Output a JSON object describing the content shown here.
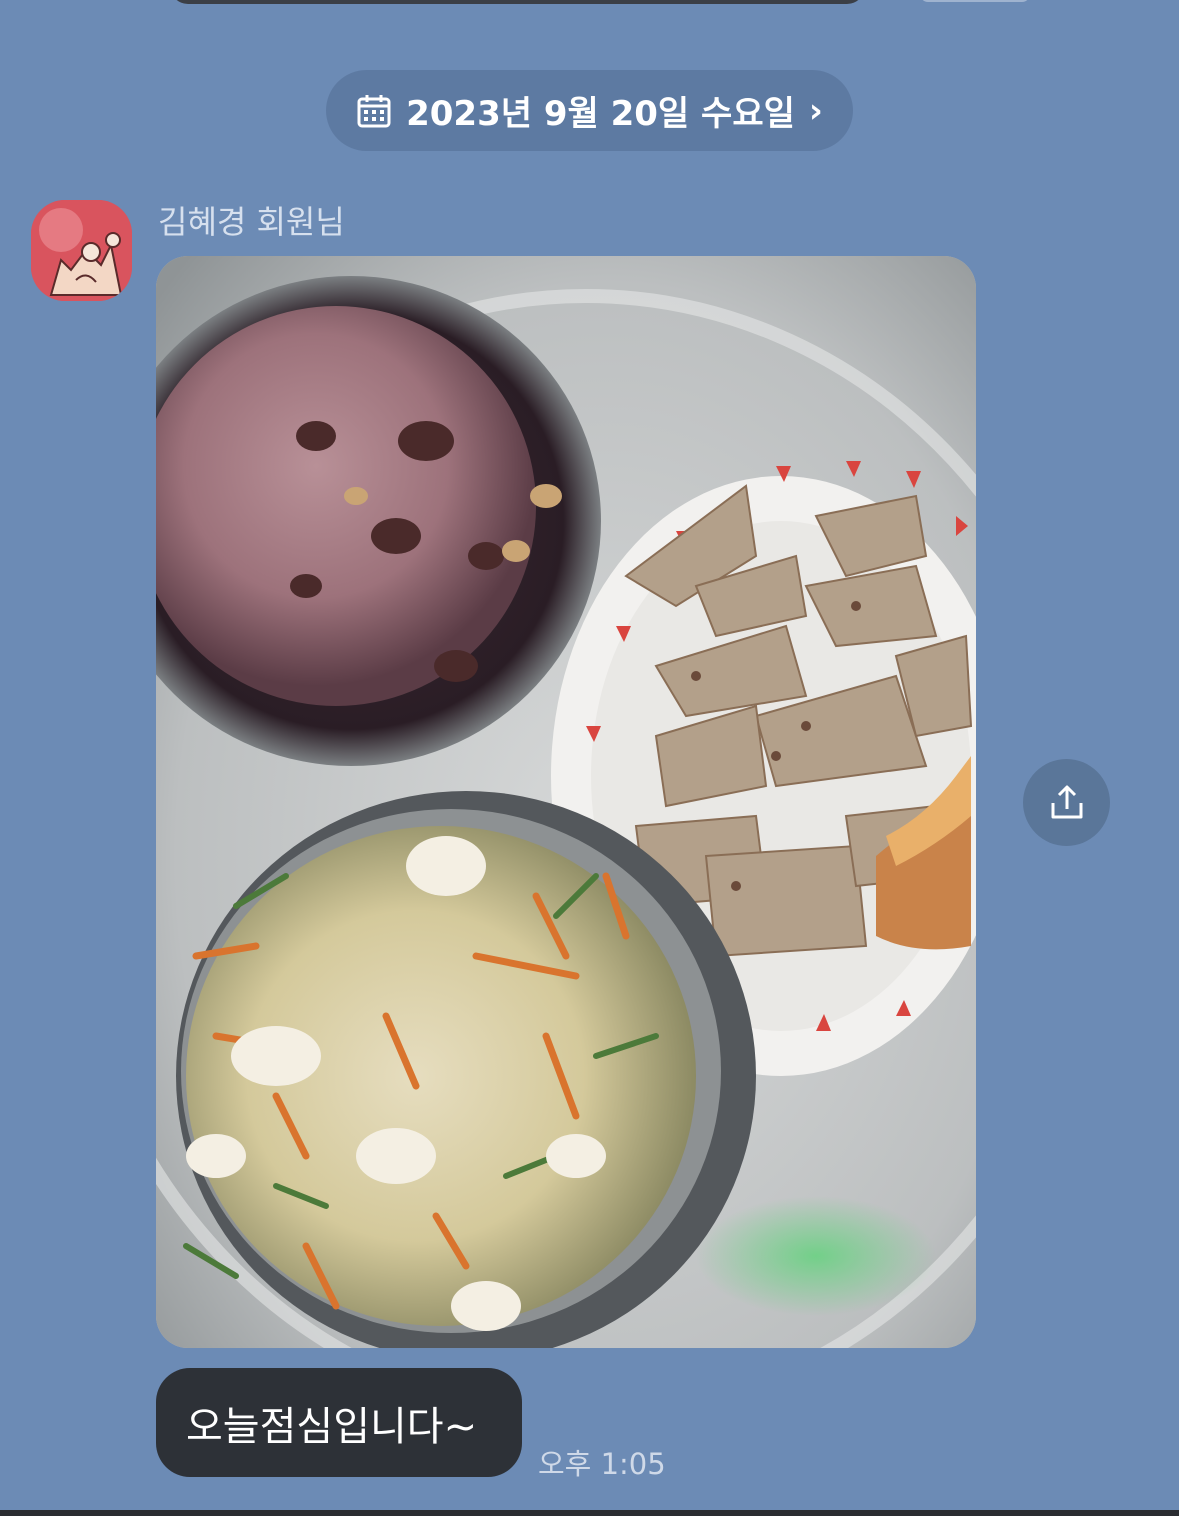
{
  "date_divider": {
    "label": "2023년 9월 20일 수요일",
    "icon": "calendar-icon",
    "chevron": "›"
  },
  "message": {
    "sender_name": "김혜경 회원님",
    "avatar_icon": "avatar-illustration",
    "photo": "meal-photo",
    "text": "오늘점심입니다~",
    "time": "오후 1:05"
  },
  "actions": {
    "share_icon": "share-icon"
  },
  "colors": {
    "background": "#6c8bb5",
    "date_pill": "#5d7aa2",
    "bubble": "#2d3137",
    "share_button": "#5a7699"
  }
}
